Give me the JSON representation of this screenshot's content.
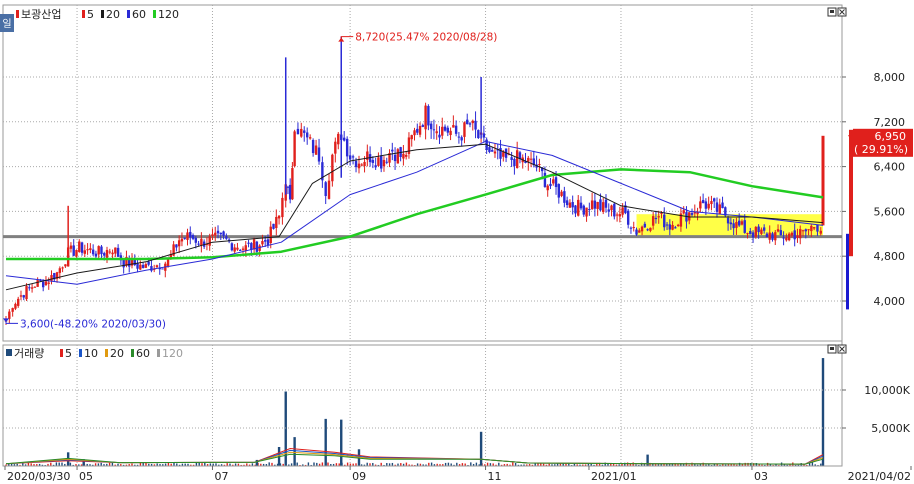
{
  "price_legend": {
    "side_tab": "일",
    "name": "보광산업",
    "ma": [
      {
        "label": "5",
        "color": "#e0201c"
      },
      {
        "label": "20",
        "color": "#1a1a1a"
      },
      {
        "label": "60",
        "color": "#2a2ad6"
      },
      {
        "label": "120",
        "color": "#22cc22"
      }
    ]
  },
  "volume_legend": {
    "name": "거래량",
    "ma": [
      {
        "label": "5",
        "color": "#e0201c"
      },
      {
        "label": "10",
        "color": "#1a55c8"
      },
      {
        "label": "20",
        "color": "#e09a10"
      },
      {
        "label": "60",
        "color": "#2a8a2a"
      },
      {
        "label": "120",
        "color": "#9a9a9a"
      }
    ]
  },
  "annotations": {
    "high": "8,720(25.47% 2020/08/28)",
    "low": "3,600(-48.20% 2020/03/30)"
  },
  "price_label": {
    "value": "6,950",
    "change": "( 29.91%)"
  },
  "colors": {
    "up": "#e0201c",
    "down": "#2a2ad6",
    "ma120": "#22cc22",
    "highlight": "#ffff33",
    "grid": "#aaaaaa",
    "support": "#808080"
  },
  "chart_data": [
    {
      "type": "candlestick",
      "title": "보광산업",
      "x_ticks": [
        "2020/03/30",
        "05",
        "07",
        "09",
        "11",
        "2021/01",
        "03",
        "2021/04/02"
      ],
      "y_ticks": [
        "4,000",
        "4,800",
        "5,600",
        "6,400",
        "7,200",
        "8,000"
      ],
      "ylim": [
        3500,
        9000
      ],
      "close_path": [
        {
          "date": "2020/03/30",
          "close": 3650
        },
        {
          "date": "2020/04/02",
          "close": 3950
        },
        {
          "date": "2020/04/07",
          "close": 4150
        },
        {
          "date": "2020/04/12",
          "close": 4300
        },
        {
          "date": "2020/04/17",
          "close": 4350
        },
        {
          "date": "2020/04/22",
          "close": 4500
        },
        {
          "date": "2020/04/27",
          "close": 4850
        },
        {
          "date": "2020/05/02",
          "close": 4950
        },
        {
          "date": "2020/05/07",
          "close": 4900
        },
        {
          "date": "2020/05/12",
          "close": 4850
        },
        {
          "date": "2020/05/17",
          "close": 4950
        },
        {
          "date": "2020/05/22",
          "close": 4700
        },
        {
          "date": "2020/05/27",
          "close": 4650
        },
        {
          "date": "2020/06/01",
          "close": 4600
        },
        {
          "date": "2020/06/06",
          "close": 4650
        },
        {
          "date": "2020/06/11",
          "close": 4700
        },
        {
          "date": "2020/06/16",
          "close": 5100
        },
        {
          "date": "2020/06/21",
          "close": 5150
        },
        {
          "date": "2020/06/26",
          "close": 5050
        },
        {
          "date": "2020/07/01",
          "close": 5100
        },
        {
          "date": "2020/07/06",
          "close": 5100
        },
        {
          "date": "2020/07/11",
          "close": 5000
        },
        {
          "date": "2020/07/16",
          "close": 4950
        },
        {
          "date": "2020/07/21",
          "close": 5000
        },
        {
          "date": "2020/07/26",
          "close": 5100
        },
        {
          "date": "2020/07/31",
          "close": 5500
        },
        {
          "date": "2020/08/03",
          "close": 6200
        },
        {
          "date": "2020/08/05",
          "close": 5700
        },
        {
          "date": "2020/08/07",
          "close": 7200
        },
        {
          "date": "2020/08/10",
          "close": 7000
        },
        {
          "date": "2020/08/14",
          "close": 6800
        },
        {
          "date": "2020/08/18",
          "close": 6600
        },
        {
          "date": "2020/08/21",
          "close": 6000
        },
        {
          "date": "2020/08/24",
          "close": 6600
        },
        {
          "date": "2020/08/28",
          "close": 7000
        },
        {
          "date": "2020/09/01",
          "close": 6600
        },
        {
          "date": "2020/09/05",
          "close": 6500
        },
        {
          "date": "2020/09/10",
          "close": 6600
        },
        {
          "date": "2020/09/15",
          "close": 6500
        },
        {
          "date": "2020/09/20",
          "close": 6700
        },
        {
          "date": "2020/09/25",
          "close": 6550
        },
        {
          "date": "2020/09/30",
          "close": 7000
        },
        {
          "date": "2020/10/05",
          "close": 7350
        },
        {
          "date": "2020/10/10",
          "close": 7100
        },
        {
          "date": "2020/10/15",
          "close": 7050
        },
        {
          "date": "2020/10/20",
          "close": 6950
        },
        {
          "date": "2020/10/25",
          "close": 7150
        },
        {
          "date": "2020/10/30",
          "close": 6850
        },
        {
          "date": "2020/11/04",
          "close": 6600
        },
        {
          "date": "2020/11/09",
          "close": 6500
        },
        {
          "date": "2020/11/14",
          "close": 6550
        },
        {
          "date": "2020/11/19",
          "close": 6500
        },
        {
          "date": "2020/11/24",
          "close": 6400
        },
        {
          "date": "2020/11/29",
          "close": 6100
        },
        {
          "date": "2020/12/04",
          "close": 5950
        },
        {
          "date": "2020/12/09",
          "close": 5750
        },
        {
          "date": "2020/12/14",
          "close": 5650
        },
        {
          "date": "2020/12/19",
          "close": 5750
        },
        {
          "date": "2020/12/24",
          "close": 5650
        },
        {
          "date": "2020/12/29",
          "close": 5600
        },
        {
          "date": "2021/01/03",
          "close": 5550
        },
        {
          "date": "2021/01/08",
          "close": 5250
        },
        {
          "date": "2021/01/13",
          "close": 5400
        },
        {
          "date": "2021/01/18",
          "close": 5500
        },
        {
          "date": "2021/01/23",
          "close": 5350
        },
        {
          "date": "2021/01/28",
          "close": 5500
        },
        {
          "date": "2021/02/02",
          "close": 5600
        },
        {
          "date": "2021/02/07",
          "close": 5750
        },
        {
          "date": "2021/02/12",
          "close": 5650
        },
        {
          "date": "2021/02/17",
          "close": 5550
        },
        {
          "date": "2021/02/22",
          "close": 5350
        },
        {
          "date": "2021/02/27",
          "close": 5250
        },
        {
          "date": "2021/03/04",
          "close": 5200
        },
        {
          "date": "2021/03/09",
          "close": 5200
        },
        {
          "date": "2021/03/14",
          "close": 5150
        },
        {
          "date": "2021/03/19",
          "close": 5200
        },
        {
          "date": "2021/03/24",
          "close": 5200
        },
        {
          "date": "2021/03/29",
          "close": 5350
        },
        {
          "date": "2021/04/01",
          "close": 5350
        },
        {
          "date": "2021/04/02",
          "close": 6950
        }
      ],
      "moving_averages": {
        "ma20": [
          {
            "date": "2020/03/30",
            "value": 4200
          },
          {
            "date": "2020/05/01",
            "value": 4500
          },
          {
            "date": "2020/06/01",
            "value": 4700
          },
          {
            "date": "2020/07/01",
            "value": 5050
          },
          {
            "date": "2020/07/31",
            "value": 5150
          },
          {
            "date": "2020/08/15",
            "value": 6100
          },
          {
            "date": "2020/09/01",
            "value": 6500
          },
          {
            "date": "2020/10/01",
            "value": 6700
          },
          {
            "date": "2020/11/01",
            "value": 6800
          },
          {
            "date": "2020/12/01",
            "value": 6300
          },
          {
            "date": "2021/01/01",
            "value": 5700
          },
          {
            "date": "2021/02/01",
            "value": 5500
          },
          {
            "date": "2021/03/01",
            "value": 5500
          },
          {
            "date": "2021/04/02",
            "value": 5400
          }
        ],
        "ma60": [
          {
            "date": "2020/03/30",
            "value": 4450
          },
          {
            "date": "2020/05/01",
            "value": 4300
          },
          {
            "date": "2020/06/01",
            "value": 4550
          },
          {
            "date": "2020/07/01",
            "value": 4750
          },
          {
            "date": "2020/08/01",
            "value": 5050
          },
          {
            "date": "2020/09/01",
            "value": 5900
          },
          {
            "date": "2020/10/01",
            "value": 6300
          },
          {
            "date": "2020/11/01",
            "value": 6850
          },
          {
            "date": "2020/12/01",
            "value": 6600
          },
          {
            "date": "2021/01/01",
            "value": 6100
          },
          {
            "date": "2021/02/01",
            "value": 5600
          },
          {
            "date": "2021/03/01",
            "value": 5500
          },
          {
            "date": "2021/04/02",
            "value": 5350
          }
        ],
        "ma120": [
          {
            "date": "2020/03/30",
            "value": 4750
          },
          {
            "date": "2020/05/01",
            "value": 4750
          },
          {
            "date": "2020/06/01",
            "value": 4750
          },
          {
            "date": "2020/07/01",
            "value": 4780
          },
          {
            "date": "2020/08/01",
            "value": 4880
          },
          {
            "date": "2020/09/01",
            "value": 5150
          },
          {
            "date": "2020/10/01",
            "value": 5550
          },
          {
            "date": "2020/11/01",
            "value": 5900
          },
          {
            "date": "2020/12/01",
            "value": 6250
          },
          {
            "date": "2021/01/01",
            "value": 6350
          },
          {
            "date": "2021/02/01",
            "value": 6300
          },
          {
            "date": "2021/03/01",
            "value": 6050
          },
          {
            "date": "2021/04/02",
            "value": 5850
          }
        ]
      },
      "support_line": 5150,
      "highlight_range": {
        "from": "2021/01/08",
        "to": "2021/04/02",
        "low": 5150,
        "high": 5550
      },
      "high_point": {
        "date": "2020/08/28",
        "value": 8720
      },
      "low_point": {
        "date": "2020/03/30",
        "value": 3600
      },
      "last_close": 6950
    },
    {
      "type": "bar",
      "title": "거래량",
      "y_ticks": [
        "5,000K",
        "10,000K"
      ],
      "ylim": [
        0,
        14000
      ],
      "unit": "K",
      "spikes": [
        {
          "date": "2020/04/27",
          "volume": 1800
        },
        {
          "date": "2020/05/04",
          "volume": 900
        },
        {
          "date": "2020/07/21",
          "volume": 800
        },
        {
          "date": "2020/07/31",
          "volume": 2500
        },
        {
          "date": "2020/08/03",
          "volume": 9800
        },
        {
          "date": "2020/08/07",
          "volume": 3800
        },
        {
          "date": "2020/08/21",
          "volume": 6200
        },
        {
          "date": "2020/08/28",
          "volume": 6100
        },
        {
          "date": "2020/09/05",
          "volume": 2200
        },
        {
          "date": "2020/10/30",
          "volume": 4500
        },
        {
          "date": "2021/01/13",
          "volume": 1500
        },
        {
          "date": "2021/04/02",
          "volume": 14200
        }
      ],
      "base_volume": 300
    }
  ]
}
